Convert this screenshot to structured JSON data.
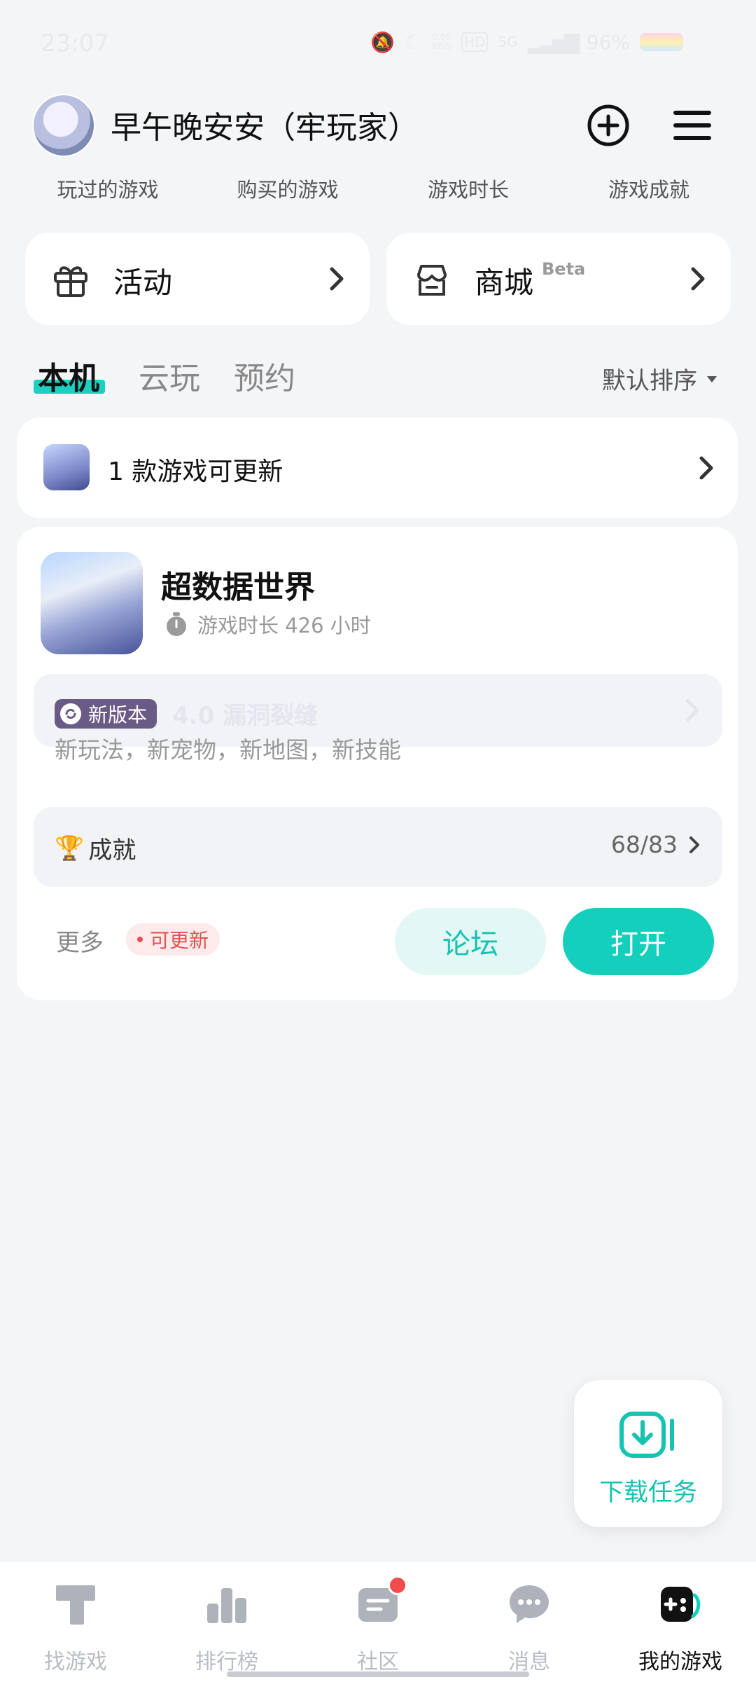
{
  "status_bar": {
    "time": "23:07",
    "speed": "0.00\nKB/S",
    "signal": "5G",
    "battery": "96%"
  },
  "header": {
    "username": "早午晚安安（牢玩家）"
  },
  "stats": [
    "玩过的游戏",
    "购买的游戏",
    "游戏时长",
    "游戏成就"
  ],
  "quick_cards": {
    "activity": "活动",
    "store": "商城",
    "store_badge": "Beta"
  },
  "tabs": {
    "local": "本机",
    "cloud": "云玩",
    "reserve": "预约"
  },
  "sort": {
    "label": "默认排序"
  },
  "updates": {
    "text": "1 款游戏可更新"
  },
  "game": {
    "name": "超数据世界",
    "playtime": "游戏时长 426 小时",
    "new_version_badge": "新版本",
    "version_title": "4.0 漏洞裂缝",
    "version_desc": "新玩法，新宠物，新地图，新技能",
    "achievement_label": "成就",
    "achievement_value": "68/83",
    "more": "更多",
    "update_tag": "可更新",
    "forum_button": "论坛",
    "open_button": "打开"
  },
  "download_fab": {
    "label": "下载任务"
  },
  "bottom_nav": [
    "找游戏",
    "排行榜",
    "社区",
    "消息",
    "我的游戏"
  ],
  "colors": {
    "accent": "#13cfbb",
    "update_red": "#e35252",
    "badge_purple": "#6a5b86"
  }
}
